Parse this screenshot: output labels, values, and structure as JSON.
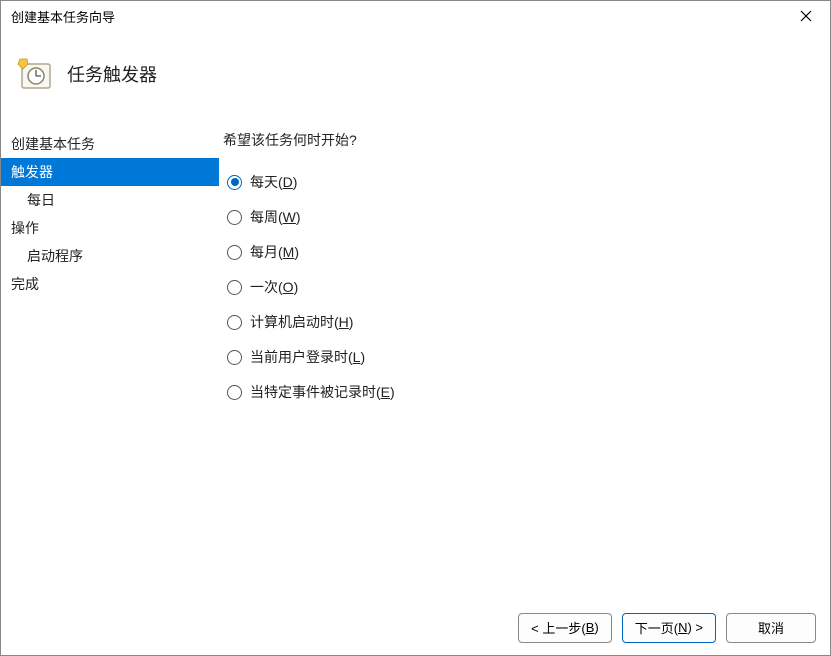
{
  "window": {
    "title": "创建基本任务向导"
  },
  "header": {
    "title": "任务触发器"
  },
  "sidebar": {
    "items": [
      {
        "label": "创建基本任务",
        "indent": false,
        "active": false
      },
      {
        "label": "触发器",
        "indent": false,
        "active": true
      },
      {
        "label": "每日",
        "indent": true,
        "active": false
      },
      {
        "label": "操作",
        "indent": false,
        "active": false
      },
      {
        "label": "启动程序",
        "indent": true,
        "active": false
      },
      {
        "label": "完成",
        "indent": false,
        "active": false
      }
    ]
  },
  "main": {
    "prompt": "希望该任务何时开始?",
    "options": [
      {
        "text": "每天",
        "key": "D",
        "selected": true
      },
      {
        "text": "每周",
        "key": "W",
        "selected": false
      },
      {
        "text": "每月",
        "key": "M",
        "selected": false
      },
      {
        "text": "一次",
        "key": "O",
        "selected": false
      },
      {
        "text": "计算机启动时",
        "key": "H",
        "selected": false
      },
      {
        "text": "当前用户登录时",
        "key": "L",
        "selected": false
      },
      {
        "text": "当特定事件被记录时",
        "key": "E",
        "selected": false
      }
    ]
  },
  "footer": {
    "back": {
      "prefix": "< 上一步(",
      "key": "B",
      "suffix": ")"
    },
    "next": {
      "prefix": "下一页(",
      "key": "N",
      "suffix": ") >"
    },
    "cancel": "取消"
  }
}
